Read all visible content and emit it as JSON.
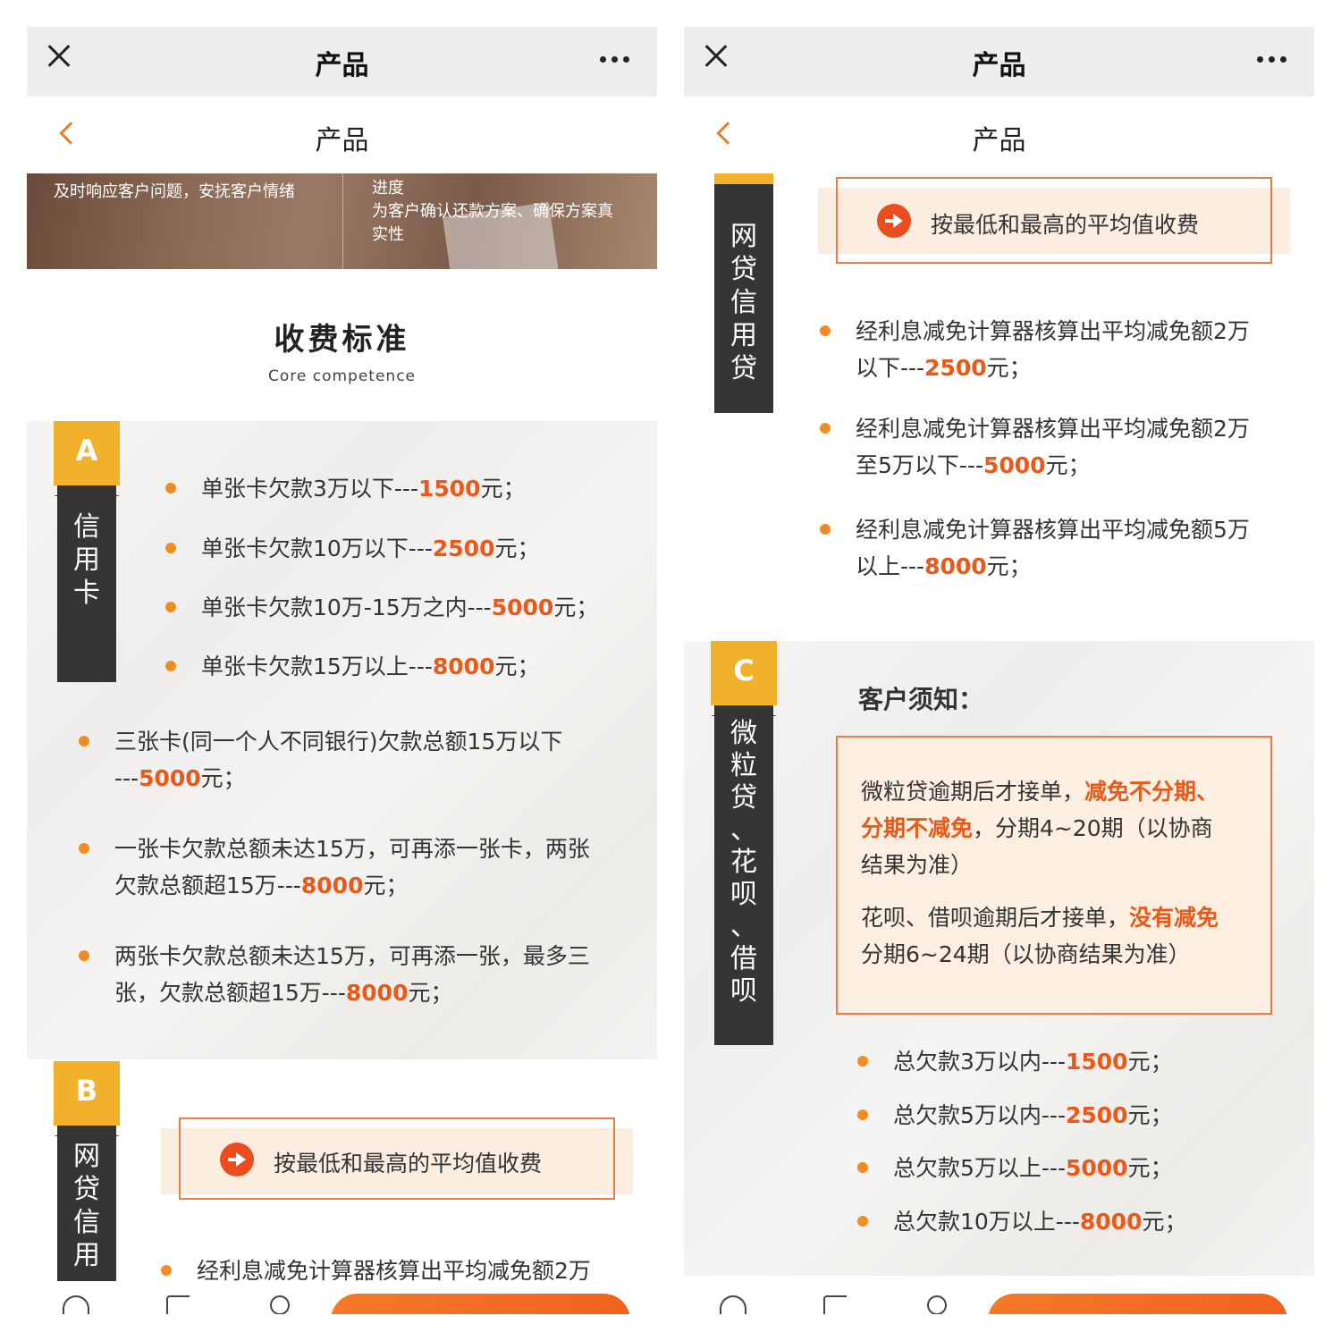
{
  "left": {
    "wx_title": "产品",
    "page_title": "产品",
    "hero": {
      "left_text": "及时响应客户问题，安抚客户情绪",
      "right_text_1": "进度",
      "right_text_2": "为客户确认还款方案、确保方案真",
      "right_text_3": "实性"
    },
    "section_title": "收费标准",
    "section_sub": "Core competence",
    "tab_a": {
      "letter": "A",
      "label": [
        "信",
        "用",
        "卡"
      ]
    },
    "credit_items": [
      {
        "pre": "单张卡欠款3万以下---",
        "amount": "1500",
        "post": "元；"
      },
      {
        "pre": "单张卡欠款10万以下---",
        "amount": "2500",
        "post": "元；"
      },
      {
        "pre": "单张卡欠款10万-15万之内---",
        "amount": "5000",
        "post": "元；"
      },
      {
        "pre": "单张卡欠款15万以上---",
        "amount": "8000",
        "post": "元；"
      }
    ],
    "multi_items": [
      {
        "line1": "三张卡(同一个人不同银行)欠款总额15万以下",
        "pre2": "---",
        "amount": "5000",
        "post": "元；"
      },
      {
        "line1": "一张卡欠款总额未达15万，可再添一张卡，两张",
        "pre2": "欠款总额超15万---",
        "amount": "8000",
        "post": "元；"
      },
      {
        "line1": "两张卡欠款总额未达15万，可再添一张，最多三",
        "pre2": "张，欠款总额超15万---",
        "amount": "8000",
        "post": "元；"
      }
    ],
    "tab_b": {
      "letter": "B",
      "label": [
        "网",
        "贷",
        "信",
        "用"
      ]
    },
    "fee_text": "按最低和最高的平均值收费",
    "cut_item": "经利息减免计算器核算出平均减免额2万"
  },
  "right": {
    "wx_title": "产品",
    "page_title": "产品",
    "tab_b_label": [
      "网",
      "贷",
      "信",
      "用",
      "贷"
    ],
    "fee_text": "按最低和最高的平均值收费",
    "loan_items": [
      {
        "line1": "经利息减免计算器核算出平均减免额2万",
        "pre2": "以下---",
        "amount": "2500",
        "post": "元；"
      },
      {
        "line1": "经利息减免计算器核算出平均减免额2万",
        "pre2": "至5万以下---",
        "amount": "5000",
        "post": "元；"
      },
      {
        "line1": "经利息减免计算器核算出平均减免额5万",
        "pre2": "以上---",
        "amount": "8000",
        "post": "元；"
      }
    ],
    "tab_c": {
      "letter": "C",
      "label": [
        "微",
        "粒",
        "贷",
        "、",
        "花",
        "呗",
        "、",
        "借",
        "呗"
      ]
    },
    "notice_title": "客户须知：",
    "notice": {
      "p1_a": "微粒贷逾期后才接单，",
      "p1_hl": "减免不分期、",
      "p2_hl": "分期不减免",
      "p2_b": "，分期4~20期（以协商",
      "p3": "结果为准）",
      "p4_a": "花呗、借呗逾期后才接单，",
      "p4_hl": "没有减免",
      "p5": "分期6~24期（以协商结果为准）"
    },
    "total_items": [
      {
        "pre": "总欠款3万以内---",
        "amount": "1500",
        "post": "元；"
      },
      {
        "pre": "总欠款5万以内---",
        "amount": "2500",
        "post": "元；"
      },
      {
        "pre": "总欠款5万以上---",
        "amount": "5000",
        "post": "元；"
      },
      {
        "pre": "总欠款10万以上---",
        "amount": "8000",
        "post": "元；"
      }
    ]
  },
  "colors": {
    "accent": "#f08c22",
    "highlight": "#e8591a",
    "tab_yellow": "#f2b12b",
    "tab_dark": "#353535"
  },
  "icons": [
    "close-icon",
    "more-icon",
    "back-icon",
    "arrow-right-icon",
    "home-icon",
    "share-icon",
    "chat-icon"
  ]
}
